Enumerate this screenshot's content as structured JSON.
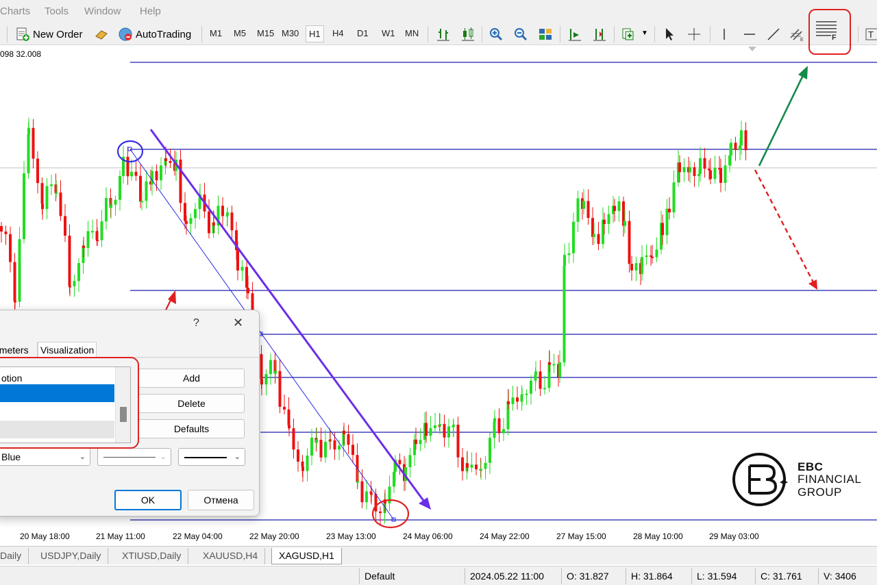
{
  "menu": [
    "Charts",
    "Tools",
    "Window",
    "Help"
  ],
  "toolbar": {
    "new_order": "New Order",
    "autotrading": "AutoTrading",
    "timeframes": [
      "M1",
      "M5",
      "M15",
      "M30",
      "H1",
      "H4",
      "D1",
      "W1",
      "MN"
    ],
    "active_timeframe": "H1",
    "icons": [
      "bar-chart-icon",
      "candlestick-icon",
      "zoom-in-icon",
      "zoom-out-icon",
      "tile-windows-icon",
      "chart-shift-icon",
      "autoscroll-icon",
      "indicators-icon",
      "cursor-icon",
      "crosshair-icon",
      "vertical-line-icon",
      "horizontal-line-icon",
      "trendline-icon",
      "equidistant-channel-icon",
      "fibonacci-icon",
      "text-icon"
    ]
  },
  "chart": {
    "price_info": "098 32.008",
    "time_labels": [
      "20 May 18:00",
      "21 May 11:00",
      "22 May 04:00",
      "22 May 20:00",
      "23 May 13:00",
      "24 May 06:00",
      "24 May 22:00",
      "27 May 15:00",
      "28 May 10:00",
      "29 May 03:00"
    ],
    "colors": {
      "bull": "#22dd22",
      "bear": "#ee1111",
      "level": "#1c1cb0",
      "trend": "#6a2ee8",
      "highlight": "#e02020",
      "up_arrow": "#138a4a"
    }
  },
  "dialog": {
    "help": "?",
    "close": "✕",
    "tabs": [
      "ameters",
      "Visualization"
    ],
    "list_header": "otion",
    "buttons": {
      "add": "Add",
      "delete": "Delete",
      "defaults": "Defaults"
    },
    "color_select": "Blue",
    "ok": "OK",
    "cancel": "Отмена"
  },
  "tabs": [
    "Daily",
    "USDJPY,Daily",
    "XTIUSD,Daily",
    "XAUUSD,H4",
    "XAGUSD,H1"
  ],
  "active_tab": "XAGUSD,H1",
  "status": {
    "profile": "Default",
    "datetime": "2024.05.22 11:00",
    "open": "O: 31.827",
    "high": "H: 31.864",
    "low": "L: 31.594",
    "close": "C: 31.761",
    "volume": "V: 3406"
  },
  "logo": {
    "line1": "EBC",
    "line2": "FINANCIAL",
    "line3": "GROUP"
  }
}
